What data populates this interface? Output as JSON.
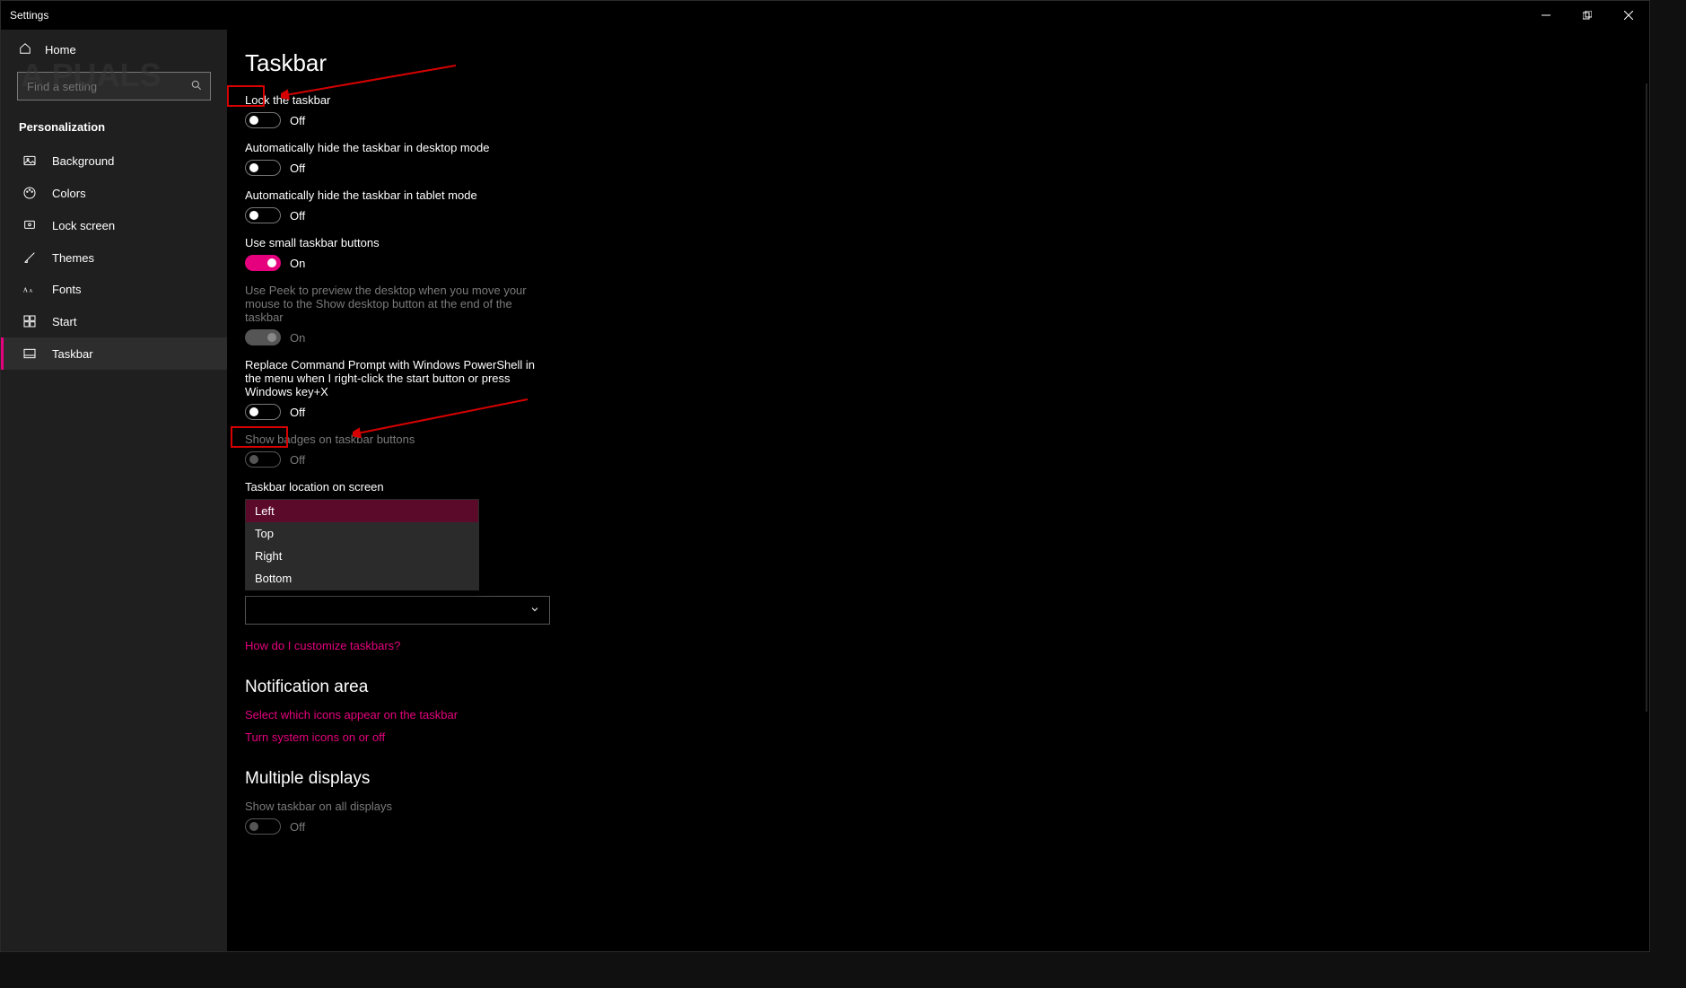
{
  "titlebar": {
    "title": "Settings"
  },
  "watermark": "A  PUALS",
  "home": {
    "label": "Home"
  },
  "search": {
    "placeholder": "Find a setting"
  },
  "category": "Personalization",
  "sidebar": {
    "items": [
      {
        "label": "Background",
        "icon": "picture"
      },
      {
        "label": "Colors",
        "icon": "palette"
      },
      {
        "label": "Lock screen",
        "icon": "lock"
      },
      {
        "label": "Themes",
        "icon": "brush"
      },
      {
        "label": "Fonts",
        "icon": "font"
      },
      {
        "label": "Start",
        "icon": "start"
      },
      {
        "label": "Taskbar",
        "icon": "taskbar"
      }
    ],
    "active_index": 6
  },
  "page": {
    "title": "Taskbar",
    "toggles": [
      {
        "label": "Lock the taskbar",
        "on": false,
        "state": "Off",
        "disabled": false,
        "highlight": true
      },
      {
        "label": "Automatically hide the taskbar in desktop mode",
        "on": false,
        "state": "Off",
        "disabled": false
      },
      {
        "label": "Automatically hide the taskbar in tablet mode",
        "on": false,
        "state": "Off",
        "disabled": false
      },
      {
        "label": "Use small taskbar buttons",
        "on": true,
        "state": "On",
        "disabled": false
      },
      {
        "label": "Use Peek to preview the desktop when you move your mouse to the Show desktop button at the end of the taskbar",
        "on": true,
        "state": "On",
        "disabled": true
      },
      {
        "label": "Replace Command Prompt with Windows PowerShell in the menu when I right-click the start button or press Windows key+X",
        "on": false,
        "state": "Off",
        "disabled": false
      },
      {
        "label": "Show badges on taskbar buttons",
        "on": false,
        "state": "Off",
        "disabled": true
      }
    ],
    "location_label": "Taskbar location on screen",
    "location_options": [
      "Left",
      "Top",
      "Right",
      "Bottom"
    ],
    "location_selected": "Left",
    "customize_link": "How do I customize taskbars?",
    "sections": {
      "notification": {
        "title": "Notification area",
        "links": [
          "Select which icons appear on the taskbar",
          "Turn system icons on or off"
        ]
      },
      "multi": {
        "title": "Multiple displays",
        "toggle": {
          "label": "Show taskbar on all displays",
          "on": false,
          "state": "Off",
          "disabled": true
        }
      }
    }
  }
}
